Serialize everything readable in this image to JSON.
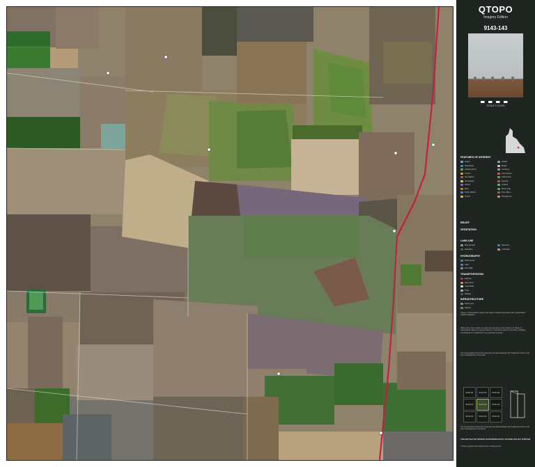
{
  "header": {
    "title": "QTOPO",
    "subtitle": "Imagery Edition",
    "sheet_number": "9143-143",
    "scale_text": "SCALE 1:10,000"
  },
  "legend": {
    "features_heading": "FEATURES OF INTEREST",
    "relief_heading": "RELIEF",
    "vegetation_heading": "VEGETATION",
    "land_use_heading": "LAND USE",
    "hydrography_heading": "HYDROGRAPHY",
    "transportation_heading": "TRANSPORTATION",
    "infrastructure_heading": "INFRASTRUCTURE",
    "feature_items": [
      {
        "label": "Airport",
        "color": "#7aa6d8"
      },
      {
        "label": "Airfield",
        "color": "#7aa6d8"
      },
      {
        "label": "Boat Ramp",
        "color": "#4f81c2"
      },
      {
        "label": "Bridge",
        "color": "#cccccc"
      },
      {
        "label": "Camping Area",
        "color": "#67a35a"
      },
      {
        "label": "Cemetery",
        "color": "#9a9a9a"
      },
      {
        "label": "Church",
        "color": "#d1a34a"
      },
      {
        "label": "Court House",
        "color": "#c75b5b"
      },
      {
        "label": "Fire Station",
        "color": "#d24a3c"
      },
      {
        "label": "Golf Course",
        "color": "#66a84c"
      },
      {
        "label": "Homestead",
        "color": "#d6c27a"
      },
      {
        "label": "Hospital",
        "color": "#d24a3c"
      },
      {
        "label": "Library",
        "color": "#7f6fb3"
      },
      {
        "label": "Lookout",
        "color": "#6fb36f"
      },
      {
        "label": "Mine",
        "color": "#b87d4b"
      },
      {
        "label": "Picnic Area",
        "color": "#67a35a"
      },
      {
        "label": "Police Station",
        "color": "#4f81c2"
      },
      {
        "label": "Post Office",
        "color": "#d24a3c"
      },
      {
        "label": "School",
        "color": "#e0b34a"
      },
      {
        "label": "Showground",
        "color": "#c69a5a"
      }
    ],
    "landuse_items": [
      {
        "label": "Built-up Area",
        "color": "#9a8f80"
      },
      {
        "label": "Reservoir",
        "color": "#4f81c2"
      },
      {
        "label": "Plantation",
        "color": "#3d6b3a"
      },
      {
        "label": "Cultivation",
        "color": "#b5a36a"
      }
    ],
    "hydro_items": [
      {
        "label": "Watercourse",
        "color": "#4f81c2"
      },
      {
        "label": "Lake",
        "color": "#4f81c2"
      },
      {
        "label": "Dam Wall",
        "color": "#8c8c8c"
      }
    ],
    "transport_items": [
      {
        "label": "Highway",
        "color": "#c8264a"
      },
      {
        "label": "Main Road",
        "color": "#e08a3c"
      },
      {
        "label": "Local Road",
        "color": "#dddddd"
      },
      {
        "label": "Track",
        "color": "#aaaaaa"
      },
      {
        "label": "Railway",
        "color": "#555555"
      }
    ],
    "infra_items": [
      {
        "label": "Power Line",
        "color": "#888888"
      },
      {
        "label": "Pipeline",
        "color": "#9c7c4a"
      }
    ]
  },
  "notes": {
    "intro": "Imagery: Queensland Imagery (QImagery). Digital topographic data: Queensland Spatial Catalogue.",
    "disclaimer": "While every care is taken to ensure the accuracy of this product, the State of Queensland makes no representations or warranties about its accuracy, reliability, completeness or suitability for any particular purpose.",
    "acknowledgement": "The Queensland Government supports and acknowledges the Traditional Owners and their custodianship of the lands.",
    "not_for_navigation": "THIS MAP MAY BE PRINTED OR REPRODUCED BY ANYONE FOR ANY PURPOSE",
    "copyright": "© State of Queensland (Department of Resources)"
  },
  "adjoining_sheets": {
    "cells": [
      "9143-411",
      "9143-412",
      "9143-421",
      "9143-133",
      "9143-143",
      "9143-144",
      "9143-131",
      "9143-132",
      "9143-141"
    ],
    "center_index": 4
  },
  "map": {
    "highway_color": "#c21f43",
    "grid_labels_top": [
      "",
      "",
      "",
      "",
      ""
    ],
    "features": [
      {
        "name": "homestead-marker"
      },
      {
        "name": "dam-marker"
      }
    ]
  }
}
